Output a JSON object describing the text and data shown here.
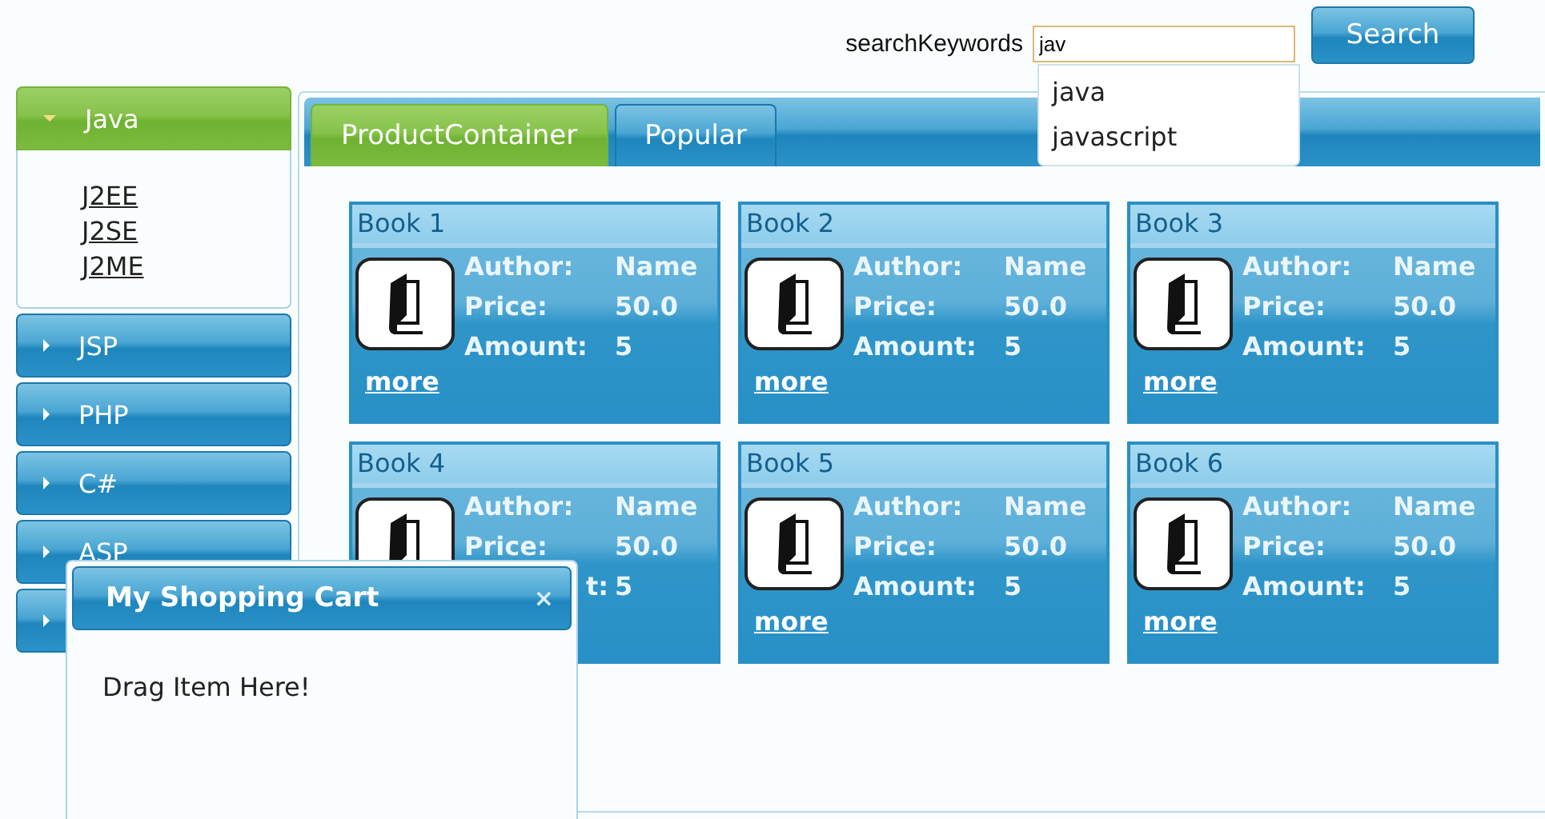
{
  "search": {
    "label": "searchKeywords",
    "value": "jav",
    "button": "Search",
    "suggestions": [
      "java",
      "javascript"
    ]
  },
  "sidebar": {
    "items": [
      {
        "label": "Java",
        "expanded": true,
        "children": [
          {
            "label": "J2EE"
          },
          {
            "label": "J2SE"
          },
          {
            "label": "J2ME"
          }
        ]
      },
      {
        "label": "JSP",
        "expanded": false
      },
      {
        "label": "PHP",
        "expanded": false
      },
      {
        "label": "C#",
        "expanded": false
      },
      {
        "label": "ASP",
        "expanded": false
      },
      {
        "expanded": false
      }
    ]
  },
  "tabs": [
    {
      "label": "ProductContainer",
      "selected": true
    },
    {
      "label": "Popular",
      "selected": false
    }
  ],
  "products": [
    {
      "title": "Book 1",
      "author_label": "Author:",
      "author": "Name",
      "price_label": "Price:",
      "price": "50.0",
      "amount_label": "Amount:",
      "amount": "5",
      "link": "more"
    },
    {
      "title": "Book 2",
      "author_label": "Author:",
      "author": "Name",
      "price_label": "Price:",
      "price": "50.0",
      "amount_label": "Amount:",
      "amount": "5",
      "link": "more"
    },
    {
      "title": "Book 3",
      "author_label": "Author:",
      "author": "Name",
      "price_label": "Price:",
      "price": "50.0",
      "amount_label": "Amount:",
      "amount": "5",
      "link": "more"
    },
    {
      "title": "Book 4",
      "author_label": "Author:",
      "author": "Name",
      "price_label": "Price:",
      "price": "50.0",
      "amount_label": "t:",
      "amount_label_cut": true,
      "amount": "5"
    },
    {
      "title": "Book 5",
      "author_label": "Author:",
      "author": "Name",
      "price_label": "Price:",
      "price": "50.0",
      "amount_label": "Amount:",
      "amount": "5",
      "link": "more"
    },
    {
      "title": "Book 6",
      "author_label": "Author:",
      "author": "Name",
      "price_label": "Price:",
      "price": "50.0",
      "amount_label": "Amount:",
      "amount": "5",
      "link": "more"
    }
  ],
  "cart": {
    "title": "My Shopping Cart",
    "close": "×",
    "message": "Drag Item Here!"
  }
}
